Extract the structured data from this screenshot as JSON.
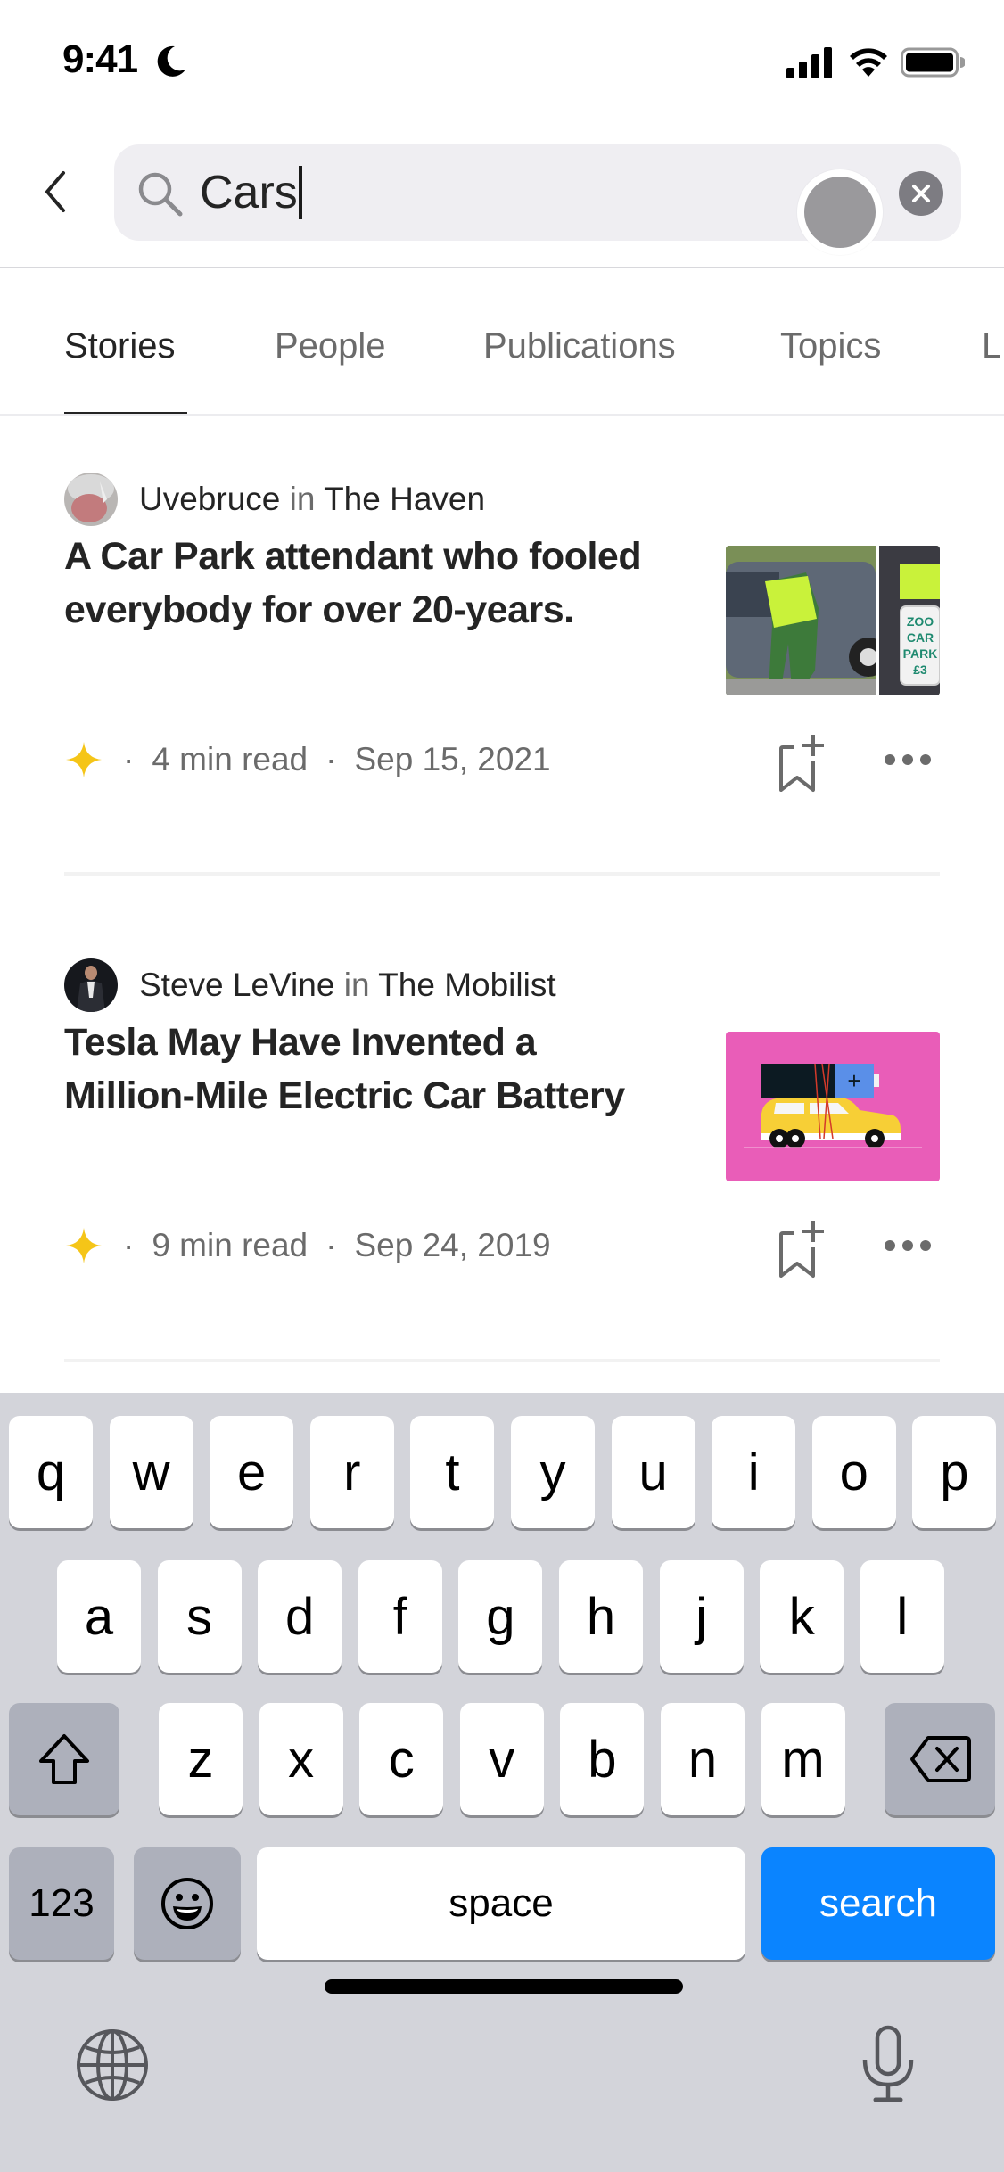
{
  "status_bar": {
    "time": "9:41",
    "focus_icon": "moon-icon",
    "signal_icon": "cellular-signal-icon",
    "wifi_icon": "wifi-icon",
    "battery_icon": "battery-icon"
  },
  "search": {
    "back_icon": "chevron-left-icon",
    "search_icon": "magnifier-icon",
    "value": "Cars",
    "clear_icon": "clear-x-icon"
  },
  "tabs": [
    {
      "label": "Stories",
      "active": true
    },
    {
      "label": "People",
      "active": false
    },
    {
      "label": "Publications",
      "active": false
    },
    {
      "label": "Topics",
      "active": false
    },
    {
      "label": "L",
      "active": false
    }
  ],
  "stories": [
    {
      "author": "Uvebruce",
      "in_word": "in",
      "publication": "The Haven",
      "title": "A Car Park attendant who fooled everybody for over 20-years.",
      "member_icon": "star-icon",
      "read_time": "4  min read",
      "date": "Sep 15, 2021",
      "separator": "·",
      "thumbnail": "Car park attendant at car window, Zoo Car Park £3 sign",
      "thumbnail_sign": [
        "ZOO",
        "CAR",
        "PARK",
        "£3"
      ]
    },
    {
      "author": "Steve LeVine",
      "in_word": "in",
      "publication": "The Mobilist",
      "title": "Tesla May Have Invented a Million-Mile Electric Car Battery",
      "member_icon": "star-icon",
      "read_time": "9  min read",
      "date": "Sep 24, 2019",
      "separator": "·",
      "thumbnail": "Illustration of yellow car carrying a battery on pink background",
      "thumbnail_battery_symbol": "+"
    }
  ],
  "keyboard": {
    "row1": [
      "q",
      "w",
      "e",
      "r",
      "t",
      "y",
      "u",
      "i",
      "o",
      "p"
    ],
    "row2": [
      "a",
      "s",
      "d",
      "f",
      "g",
      "h",
      "j",
      "k",
      "l"
    ],
    "row3": [
      "z",
      "x",
      "c",
      "v",
      "b",
      "n",
      "m"
    ],
    "shift_icon": "shift-arrow-icon",
    "delete_icon": "backspace-icon",
    "numbers_label": "123",
    "emoji_icon": "emoji-face-icon",
    "space_label": "space",
    "action_label": "search",
    "globe_icon": "globe-icon",
    "mic_icon": "microphone-icon"
  },
  "colors": {
    "accent_blue": "#0a84ff",
    "star_yellow": "#f5c518",
    "thumb_pink": "#e95db8",
    "text_primary": "#242424",
    "text_secondary": "#6b6b6b"
  }
}
